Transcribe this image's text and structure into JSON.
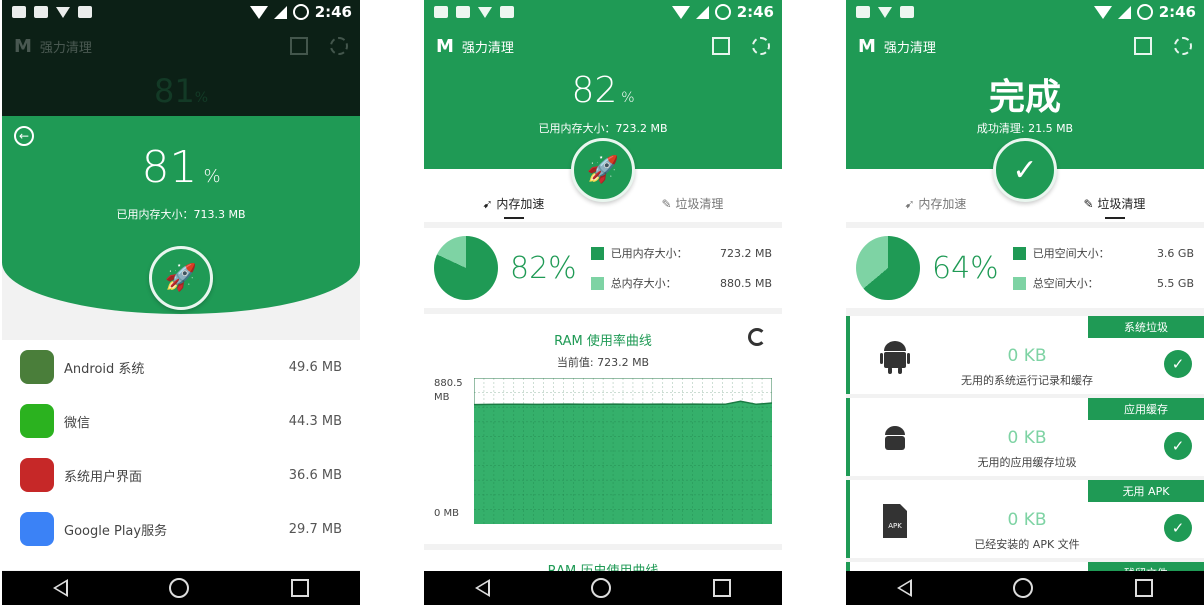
{
  "status": {
    "time": "2:46"
  },
  "app": {
    "logo": "M",
    "title": "强力清理"
  },
  "screen1": {
    "ghost_pct": "81",
    "ghost_unit": "%",
    "percent": "81",
    "percent_unit": "%",
    "memory_used": "已用内存大小：713.3 MB",
    "apps": [
      {
        "name": "Android 系统",
        "size": "49.6 MB",
        "icon_color": "#4a7e3a",
        "icon": "android-icon"
      },
      {
        "name": "微信",
        "size": "44.3 MB",
        "icon_color": "#2bb21f",
        "icon": "wechat-icon"
      },
      {
        "name": "系统用户界面",
        "size": "36.6 MB",
        "icon_color": "#c62828",
        "icon": "android-logo-icon"
      },
      {
        "name": "Google Play服务",
        "size": "29.7 MB",
        "icon_color": "#3b82f6",
        "icon": "puzzle-icon"
      }
    ]
  },
  "screen2": {
    "percent": "82",
    "percent_unit": "%",
    "memory_used": "已用内存大小：723.2 MB",
    "tabs": [
      "内存加速",
      "垃圾清理"
    ],
    "pie_pct": "82%",
    "legend": [
      {
        "label": "已用内存大小：",
        "value": "723.2 MB",
        "color": "#1f9a55"
      },
      {
        "label": "总内存大小：",
        "value": "880.5 MB",
        "color": "#7ed3a4"
      }
    ],
    "chart_title": "RAM 使用率曲线",
    "chart_current": "当前值: 723.2 MB",
    "y_max_label_1": "880.5",
    "y_max_label_2": "MB",
    "y_min_label": "0 MB",
    "next_card_title": "RAM 历史使用曲线"
  },
  "screen3": {
    "title": "完成",
    "cleaned": "成功清理: 21.5 MB",
    "tabs": [
      "内存加速",
      "垃圾清理"
    ],
    "pie_pct": "64%",
    "legend": [
      {
        "label": "已用空间大小：",
        "value": "3.6 GB",
        "color": "#1f9a55"
      },
      {
        "label": "总空间大小：",
        "value": "5.5 GB",
        "color": "#7ed3a4"
      }
    ],
    "items": [
      {
        "tag": "系统垃圾",
        "size": "0 KB",
        "desc": "无用的系统运行记录和缓存",
        "icon": "android-icon"
      },
      {
        "tag": "应用缓存",
        "size": "0 KB",
        "desc": "无用的应用缓存垃圾",
        "icon": "android-icon"
      },
      {
        "tag": "无用 APK",
        "size": "0 KB",
        "desc": "已经安装的 APK 文件",
        "icon": "apk-file-icon",
        "icon_label": "APK"
      }
    ],
    "cut_tag": "残留文件"
  },
  "chart_data": {
    "type": "area",
    "title": "RAM 使用率曲线",
    "ylabel": "",
    "ylim": [
      0,
      880.5
    ],
    "y_unit": "MB",
    "x": [
      1,
      2,
      3,
      4,
      5,
      6,
      7,
      8,
      9,
      10,
      11,
      12,
      13,
      14,
      15,
      16,
      17,
      18,
      19,
      20
    ],
    "series": [
      {
        "values": [
          720,
          721,
          722,
          722,
          721,
          722,
          723,
          722,
          722,
          723,
          722,
          722,
          723,
          722,
          723,
          722,
          722,
          740,
          722,
          730
        ]
      }
    ]
  },
  "colors": {
    "primary": "#1f9a55",
    "light": "#7ed3a4",
    "dim": "#0c2016"
  }
}
